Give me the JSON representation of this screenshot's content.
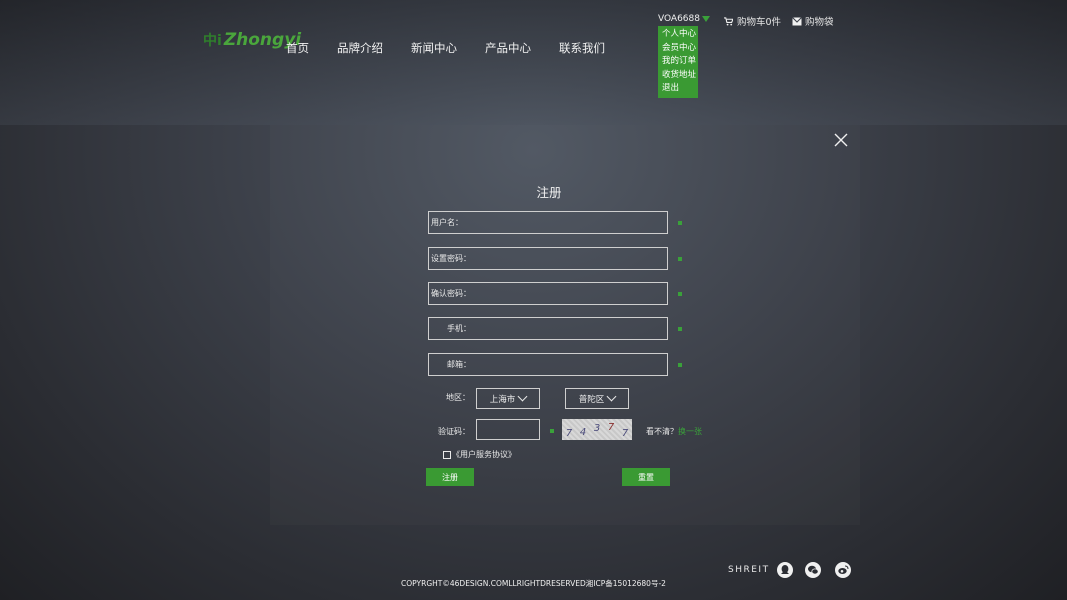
{
  "header": {
    "logo_cn": "中i",
    "logo_en": "Zhongyi",
    "nav": [
      "首页",
      "品牌介绍",
      "新闻中心",
      "产品中心",
      "联系我们"
    ],
    "user": {
      "name": "VOA6688",
      "menu": [
        "个人中心",
        "会员中心",
        "我的订单",
        "收货地址",
        "退出"
      ]
    },
    "cart_label": "购物车0件",
    "bag_label": "购物袋"
  },
  "form": {
    "title": "注册",
    "fields": {
      "username": "用户名：",
      "password": "设置密码：",
      "confirm": "确认密码：",
      "phone": "手机：",
      "email": "邮箱："
    },
    "region_label": "地区：",
    "city": "上海市",
    "district": "普陀区",
    "captcha_label": "验证码：",
    "captcha_text": [
      "7",
      "4",
      "3",
      "7",
      "7"
    ],
    "refresh_hint": "看不清？",
    "refresh_link": "换一张",
    "agreement": "《用户服务协议》",
    "register_button": "注册",
    "reset_button": "重置"
  },
  "footer": {
    "brand": "SHREIT",
    "copyright": "COPYRGHT©46DESIGN.COMLLRIGHTDRESERVED湘ICP备15012680号-2",
    "social_icons": [
      "qq-icon",
      "wechat-icon",
      "weibo-icon"
    ]
  },
  "colors": {
    "accent": "#3a9a33",
    "background": "#3c4049"
  }
}
